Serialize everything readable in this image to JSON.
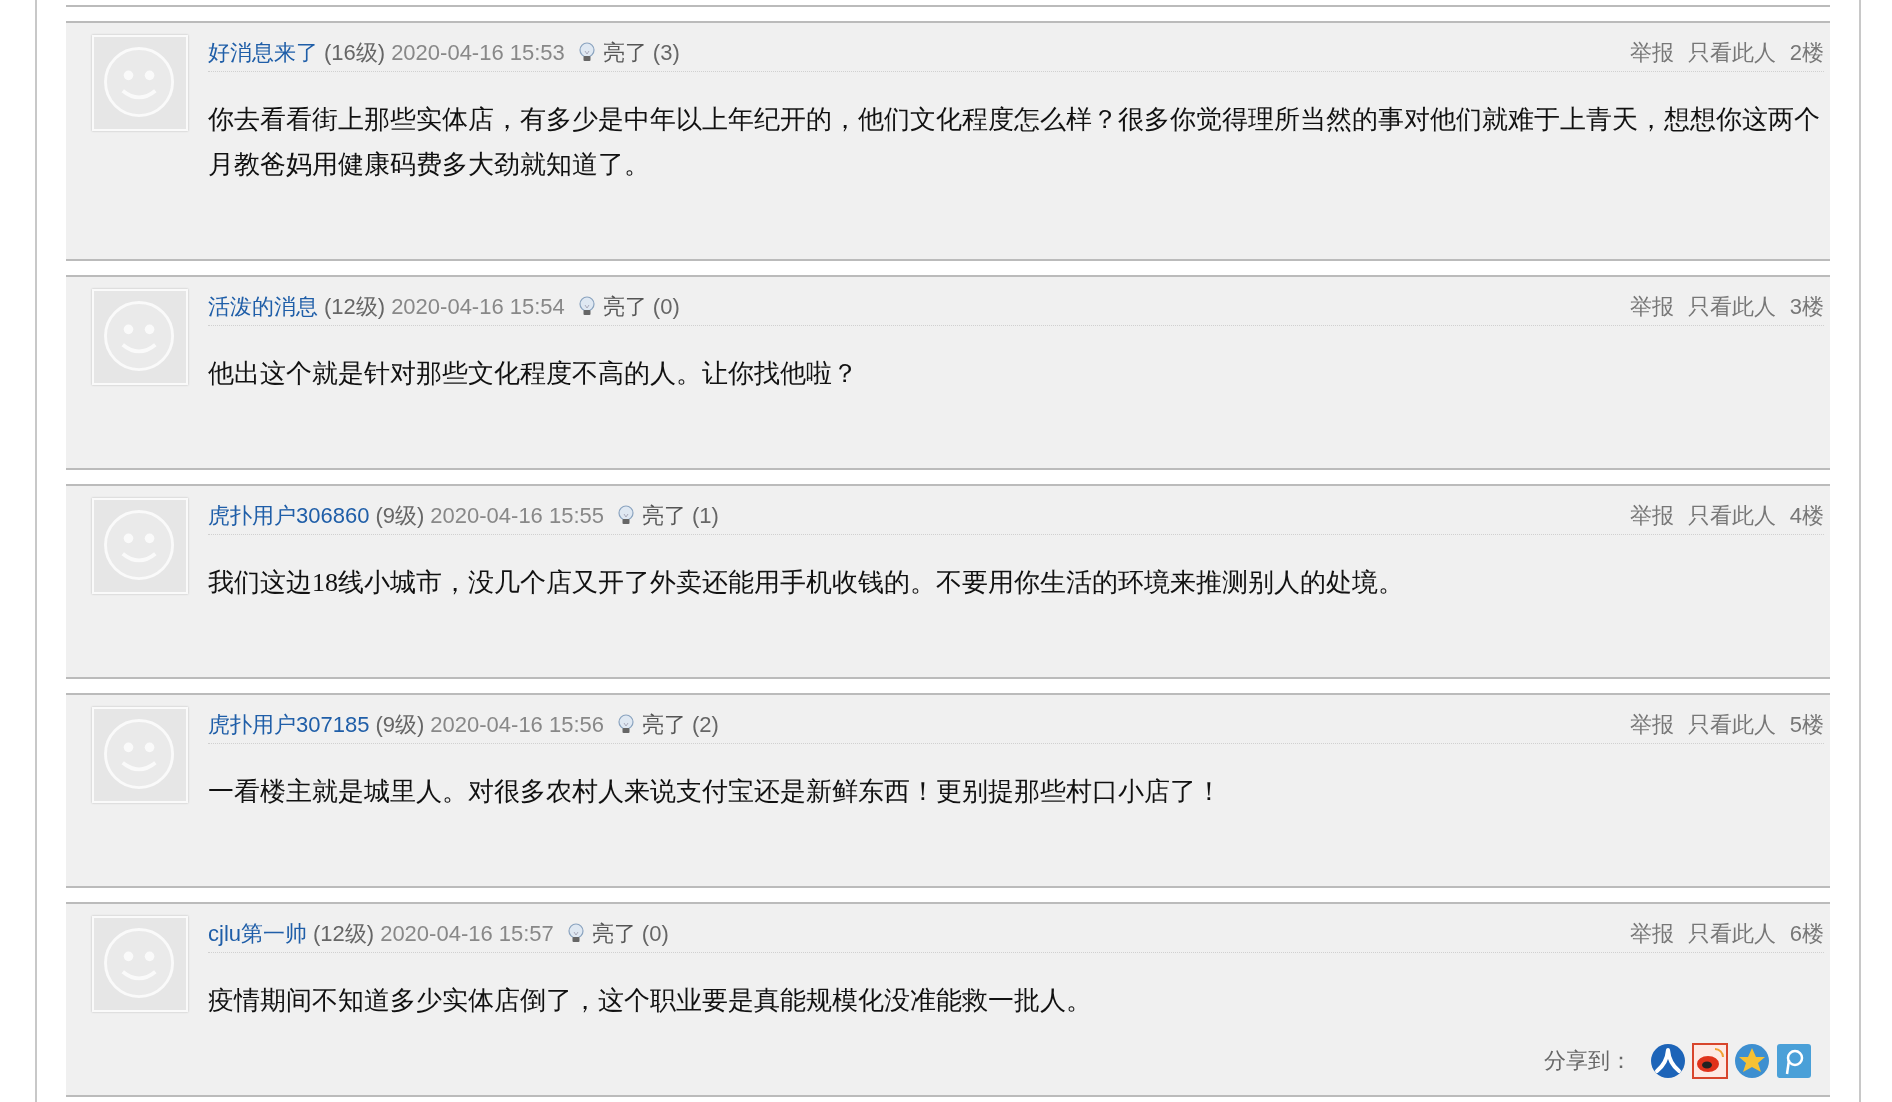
{
  "posts": [
    {
      "user": "好消息来了",
      "level": "(16级)",
      "time": "2020-04-16 15:53",
      "light_label": "亮了",
      "light_count": "(3)",
      "actions": [
        "举报",
        "只看此人"
      ],
      "floor": "2楼",
      "body": "你去看看街上那些实体店，有多少是中年以上年纪开的，他们文化程度怎么样？很多你觉得理所当然的事对他们就难于上青天，想想你这两个月教爸妈用健康码费多大劲就知道了。"
    },
    {
      "user": "活泼的消息",
      "level": "(12级)",
      "time": "2020-04-16 15:54",
      "light_label": "亮了",
      "light_count": "(0)",
      "actions": [
        "举报",
        "只看此人"
      ],
      "floor": "3楼",
      "body": "他出这个就是针对那些文化程度不高的人。让你找他啦？"
    },
    {
      "user": "虎扑用户306860",
      "level": "(9级)",
      "time": "2020-04-16 15:55",
      "light_label": "亮了",
      "light_count": "(1)",
      "actions": [
        "举报",
        "只看此人"
      ],
      "floor": "4楼",
      "body": "我们这边18线小城市，没几个店又开了外卖还能用手机收钱的。不要用你生活的环境来推测别人的处境。"
    },
    {
      "user": "虎扑用户307185",
      "level": "(9级)",
      "time": "2020-04-16 15:56",
      "light_label": "亮了",
      "light_count": "(2)",
      "actions": [
        "举报",
        "只看此人"
      ],
      "floor": "5楼",
      "body": "一看楼主就是城里人。对很多农村人来说支付宝还是新鲜东西！更别提那些村口小店了！"
    },
    {
      "user": "cjlu第一帅",
      "level": "(12级)",
      "time": "2020-04-16 15:57",
      "light_label": "亮了",
      "light_count": "(0)",
      "actions": [
        "举报",
        "只看此人"
      ],
      "floor": "6楼",
      "body": "疫情期间不知道多少实体店倒了，这个职业要是真能规模化没准能救一批人。",
      "share": {
        "label": "分享到：",
        "targets": [
          {
            "kind": "renren"
          },
          {
            "kind": "weibo"
          },
          {
            "kind": "qzone"
          },
          {
            "kind": "tqq"
          }
        ]
      }
    }
  ]
}
